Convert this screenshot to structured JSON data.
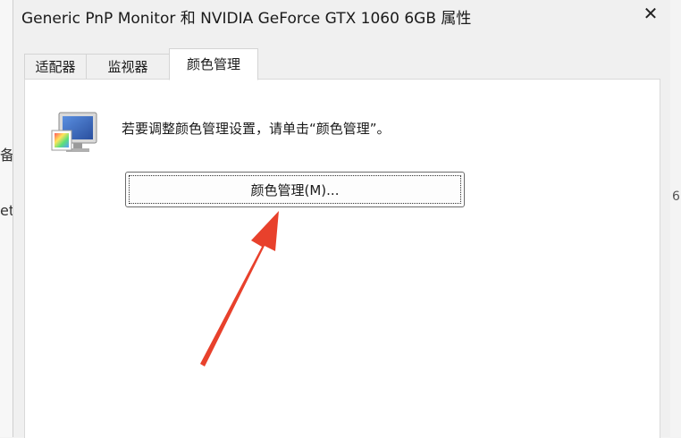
{
  "background": {
    "left_fragment_1": "备",
    "left_fragment_2": "et",
    "right_fragment": "6"
  },
  "window": {
    "title": "Generic PnP Monitor 和 NVIDIA GeForce GTX 1060 6GB 属性",
    "close_glyph": "✕"
  },
  "tabs": [
    {
      "label": "适配器"
    },
    {
      "label": "监视器"
    },
    {
      "label": "颜色管理",
      "selected": true
    }
  ],
  "panel": {
    "icon": "color-monitor-icon",
    "instruction": "若要调整颜色管理设置，请单击“颜色管理”。",
    "button_label": "颜色管理(M)..."
  },
  "annotation": {
    "icon": "red-arrow-icon",
    "color": "#e8412c"
  }
}
